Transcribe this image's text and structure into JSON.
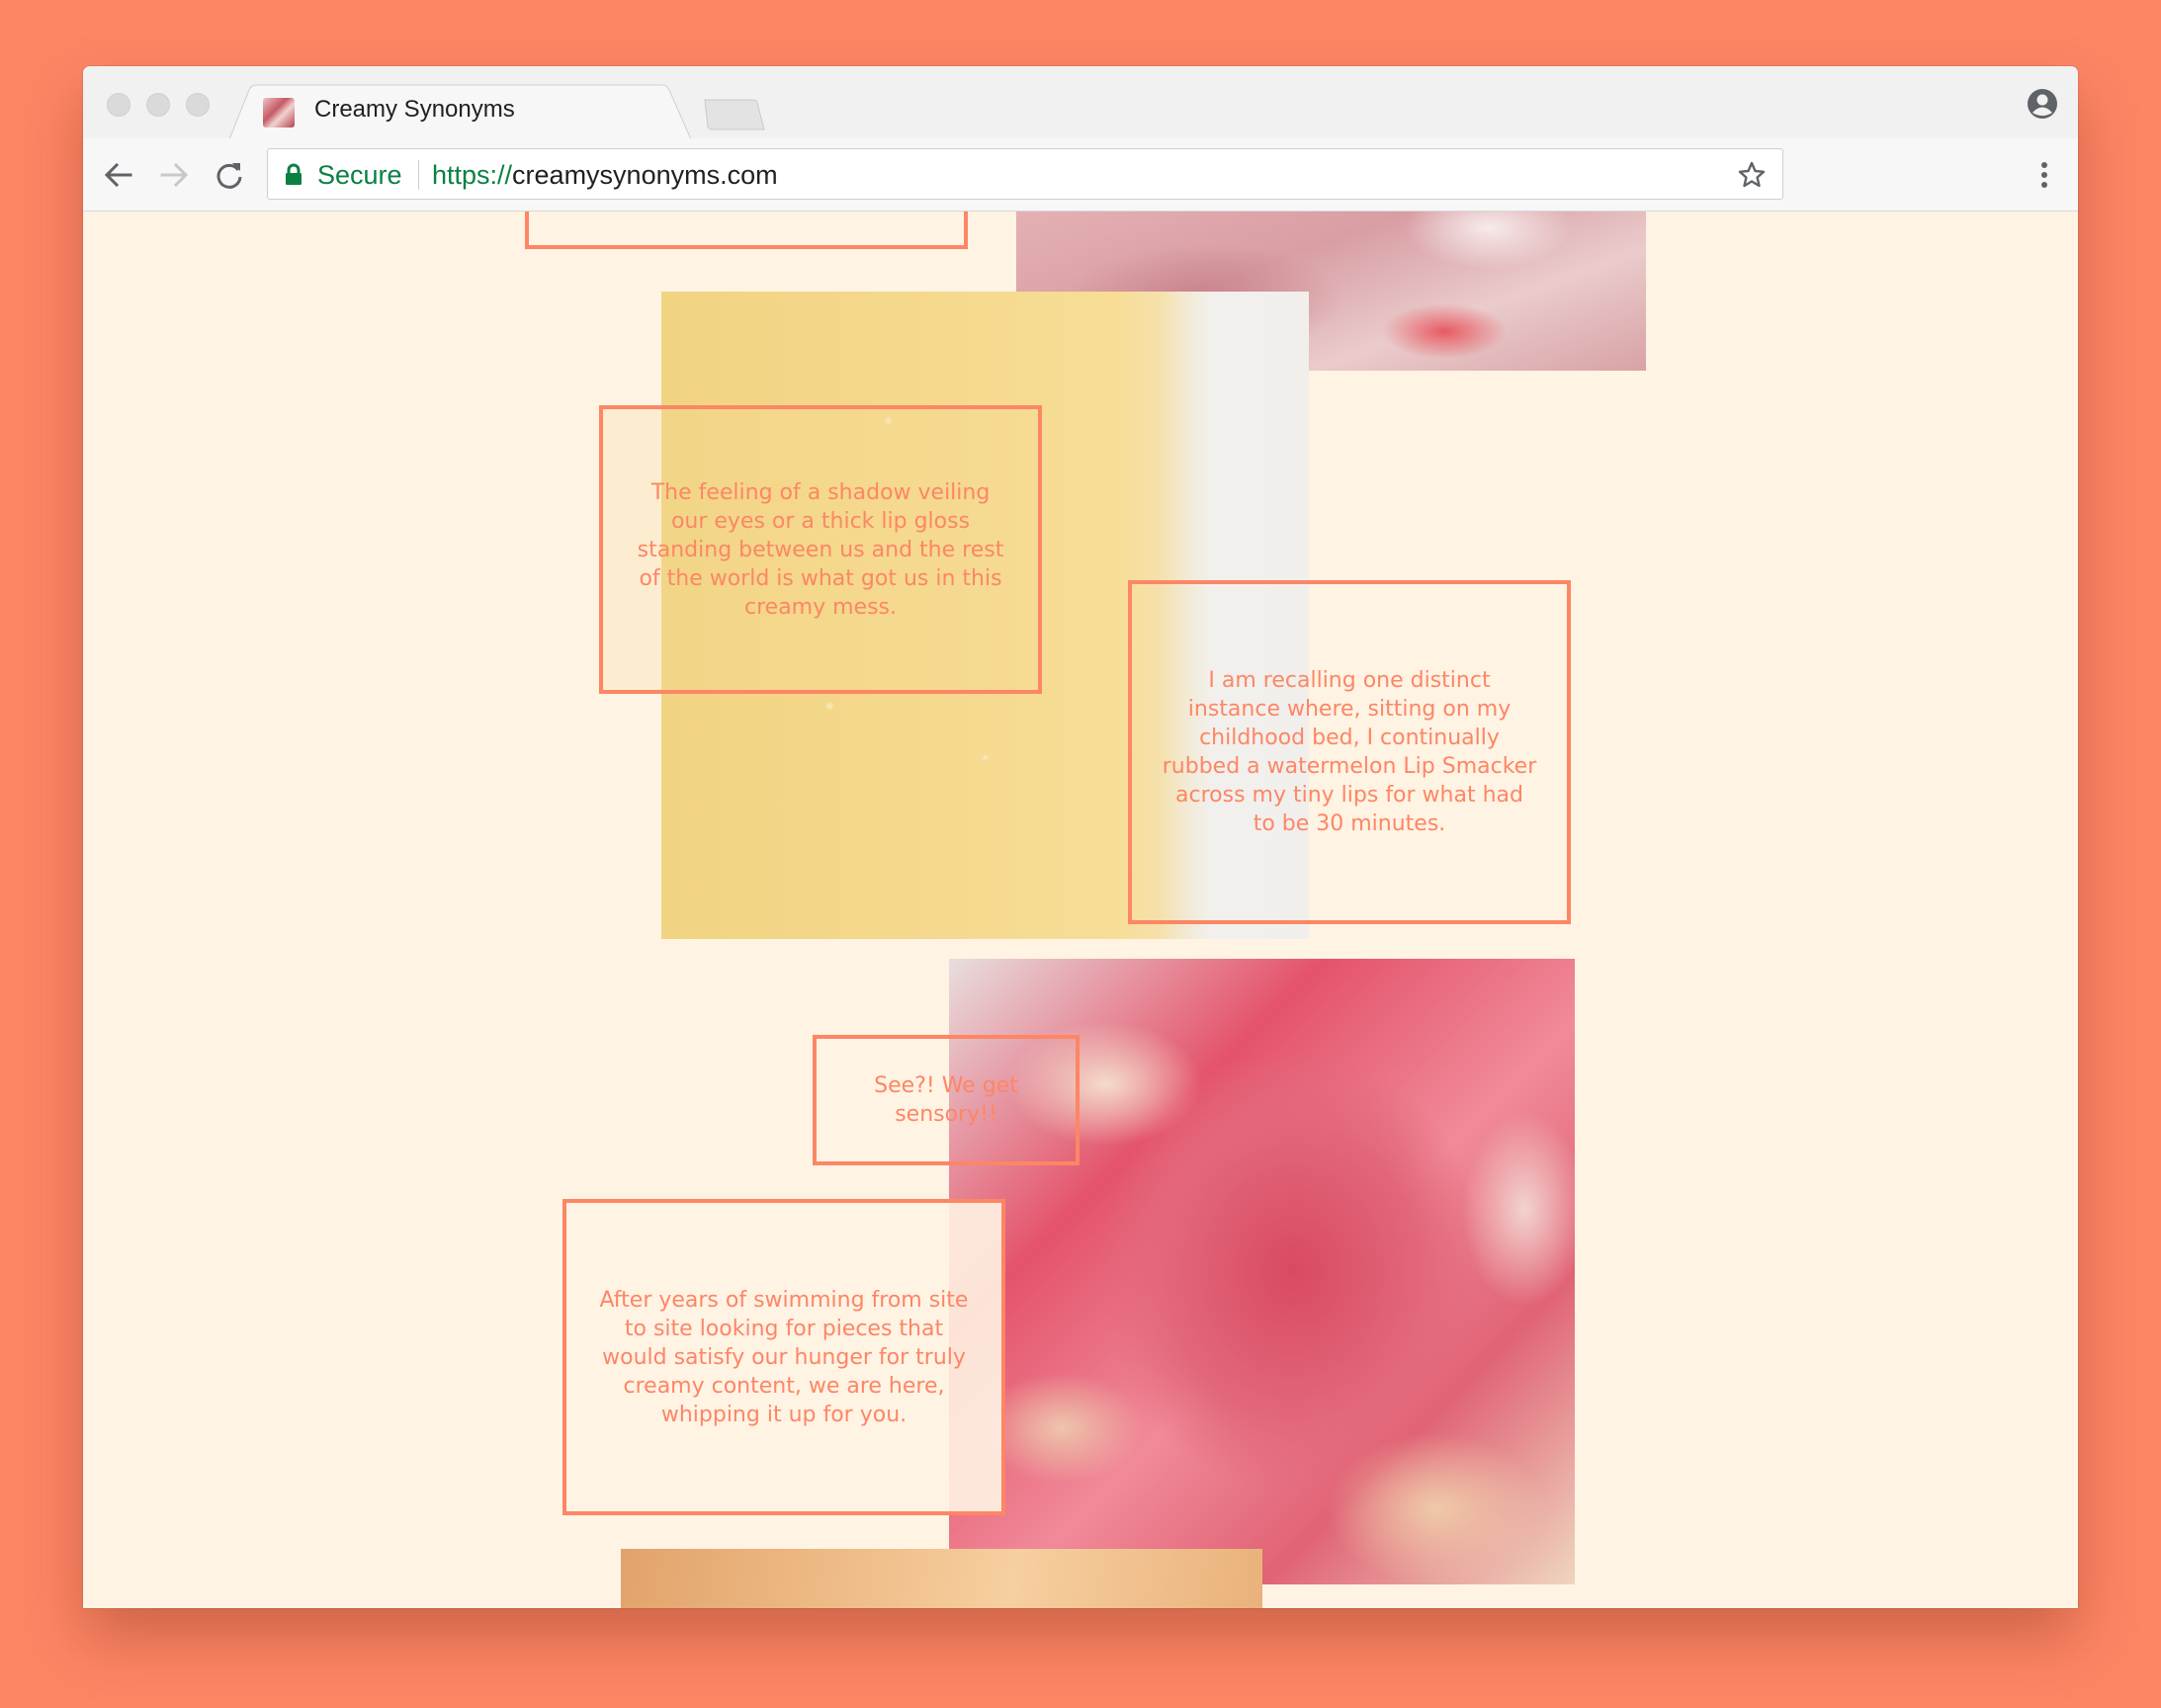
{
  "browser": {
    "tab_title": "Creamy Synonyms",
    "tab_close": "✕",
    "secure_label": "Secure",
    "url_scheme": "https://",
    "url_host": "creamysynonyms.com"
  },
  "page": {
    "texts": [
      "The feeling of a shadow veiling our eyes or a thick lip gloss standing between us and the rest of the world is what got us in this creamy mess.",
      "I am recalling one distinct instance where, sitting on my childhood bed, I continually rubbed a watermelon Lip Smacker across my tiny lips for what had to be 30 minutes.",
      "See?! We get sensory!!",
      "After years of swimming from site to site looking for pieces that would satisfy our hunger for truly creamy content, we are here, whipping it up for you."
    ]
  },
  "colors": {
    "accent": "#fd8665",
    "page_background": "#fff3e3",
    "secure_green": "#0b8043"
  },
  "icons": [
    "back-arrow-icon",
    "forward-arrow-icon",
    "reload-icon",
    "lock-icon",
    "star-icon",
    "menu-dots-icon",
    "account-icon",
    "close-icon"
  ]
}
